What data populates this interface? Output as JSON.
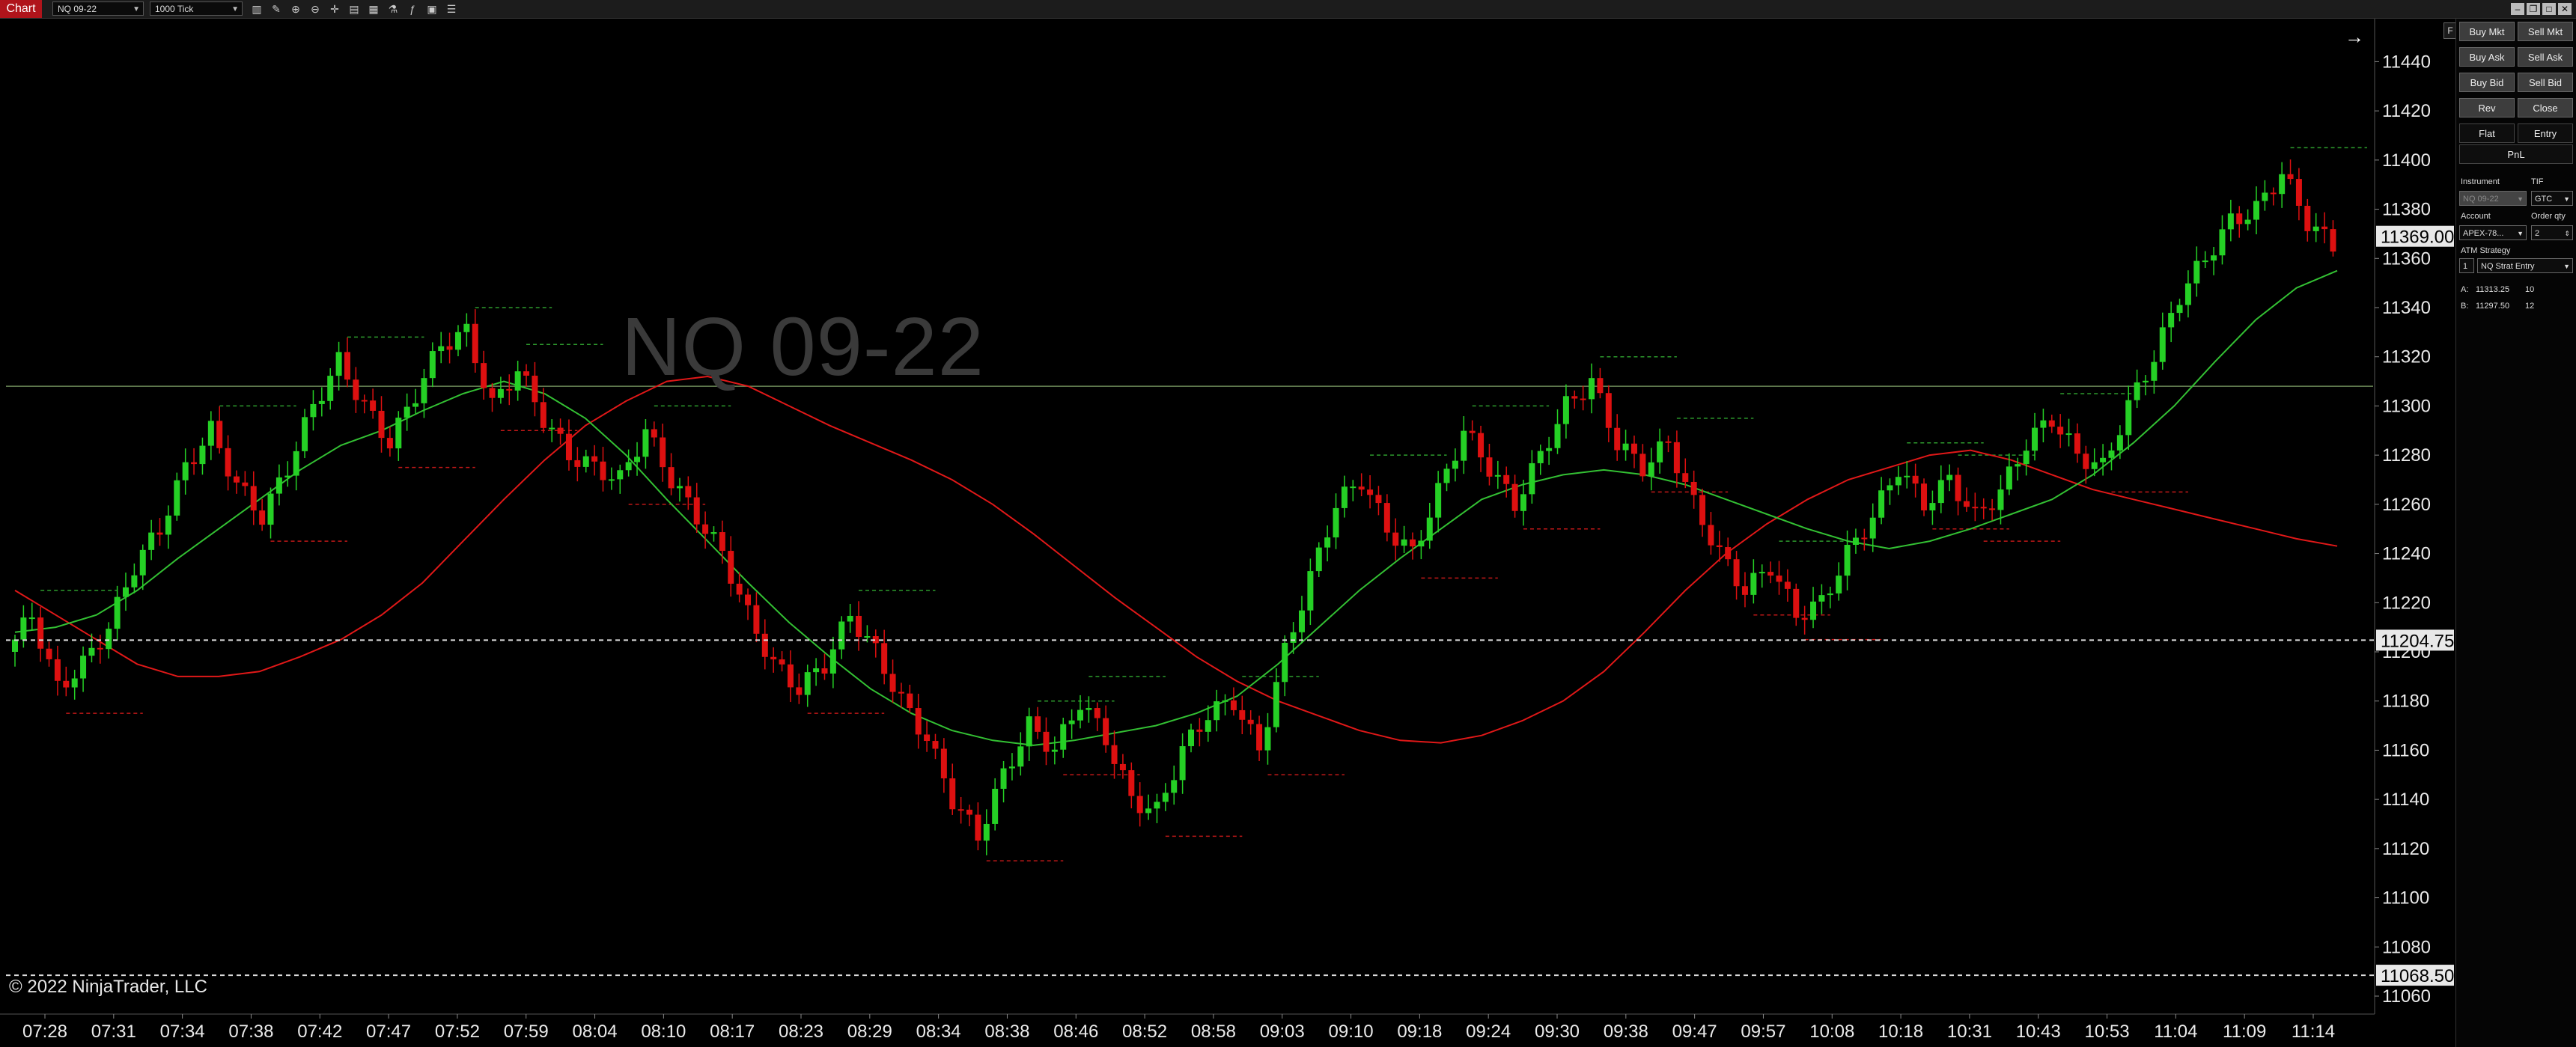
{
  "toolbar": {
    "tab_label": "Chart",
    "instrument": "NQ 09-22",
    "bar_type": "1000 Tick",
    "icons": [
      "bars-icon",
      "pencil-icon",
      "zoom-in-icon",
      "zoom-out-icon",
      "crosshair-icon",
      "data-box-icon",
      "properties-icon",
      "strategies-icon",
      "indicators-icon",
      "templates-icon"
    ]
  },
  "chart": {
    "watermark": "NQ 09-22",
    "copyright": "© 2022 NinjaTrader, LLC",
    "colors": {
      "up": "#25d025",
      "down": "#dd1010",
      "green_ma": "#33c033",
      "red_ma": "#e01818",
      "bg": "#000000"
    }
  },
  "chart_data": {
    "type": "candlestick",
    "instrument": "NQ 09-22",
    "ylim": [
      11060,
      11450
    ],
    "y_ticks": [
      11060,
      11080,
      11100,
      11120,
      11140,
      11160,
      11180,
      11200,
      11220,
      11240,
      11260,
      11280,
      11300,
      11320,
      11340,
      11360,
      11380,
      11400,
      11420,
      11440
    ],
    "x_ticks": [
      "07:28",
      "07:31",
      "07:34",
      "07:38",
      "07:42",
      "07:47",
      "07:52",
      "07:59",
      "08:04",
      "08:10",
      "08:17",
      "08:23",
      "08:29",
      "08:34",
      "08:38",
      "08:46",
      "08:52",
      "08:58",
      "09:03",
      "09:10",
      "09:18",
      "09:24",
      "09:30",
      "09:38",
      "09:47",
      "09:57",
      "10:08",
      "10:18",
      "10:31",
      "10:43",
      "10:53",
      "11:04",
      "11:09",
      "11:14"
    ],
    "price_markers": {
      "last_price": 11369.0,
      "ask_line": 11204.75,
      "bottom_line": 11068.5
    },
    "horizontal_line": 11308,
    "close_path": [
      11200,
      11215,
      11185,
      11195,
      11210,
      11235,
      11250,
      11275,
      11290,
      11268,
      11255,
      11275,
      11300,
      11318,
      11300,
      11285,
      11305,
      11325,
      11330,
      11300,
      11315,
      11295,
      11280,
      11275,
      11270,
      11290,
      11270,
      11255,
      11240,
      11215,
      11195,
      11185,
      11195,
      11215,
      11200,
      11180,
      11165,
      11140,
      11125,
      11150,
      11170,
      11160,
      11180,
      11165,
      11140,
      11135,
      11160,
      11175,
      11180,
      11160,
      11200,
      11230,
      11260,
      11270,
      11250,
      11240,
      11265,
      11290,
      11275,
      11260,
      11280,
      11300,
      11310,
      11285,
      11275,
      11285,
      11260,
      11240,
      11225,
      11235,
      11215,
      11220,
      11240,
      11255,
      11275,
      11260,
      11270,
      11255,
      11265,
      11285,
      11295,
      11280,
      11275,
      11300,
      11320,
      11345,
      11360,
      11375,
      11380,
      11395,
      11375,
      11365
    ],
    "green_ma": [
      11208,
      11210,
      11215,
      11225,
      11238,
      11250,
      11262,
      11274,
      11284,
      11290,
      11298,
      11305,
      11310,
      11305,
      11295,
      11280,
      11262,
      11245,
      11228,
      11212,
      11198,
      11185,
      11175,
      11168,
      11164,
      11162,
      11164,
      11167,
      11170,
      11175,
      11182,
      11195,
      11210,
      11225,
      11238,
      11250,
      11262,
      11268,
      11272,
      11274,
      11272,
      11268,
      11262,
      11256,
      11250,
      11245,
      11242,
      11245,
      11250,
      11256,
      11262,
      11272,
      11285,
      11300,
      11318,
      11335,
      11348,
      11355
    ],
    "red_ma": [
      11225,
      11215,
      11205,
      11195,
      11190,
      11190,
      11192,
      11198,
      11205,
      11215,
      11228,
      11245,
      11262,
      11278,
      11292,
      11302,
      11310,
      11312,
      11308,
      11300,
      11292,
      11285,
      11278,
      11270,
      11260,
      11248,
      11235,
      11222,
      11210,
      11198,
      11188,
      11180,
      11174,
      11168,
      11164,
      11163,
      11166,
      11172,
      11180,
      11192,
      11208,
      11225,
      11240,
      11252,
      11262,
      11270,
      11275,
      11280,
      11282,
      11278,
      11272,
      11266,
      11262,
      11258,
      11254,
      11250,
      11246,
      11243
    ]
  },
  "panel": {
    "f_button": "F",
    "buttons": [
      {
        "left": "Buy Mkt",
        "right": "Sell Mkt"
      },
      {
        "left": "Buy Ask",
        "right": "Sell Ask"
      },
      {
        "left": "Buy Bid",
        "right": "Sell Bid"
      },
      {
        "left": "Rev",
        "right": "Close"
      }
    ],
    "flat": "Flat",
    "entry": "Entry",
    "pnl": "PnL",
    "instrument_label": "Instrument",
    "instrument_value": "NQ 09-22",
    "tif_label": "TIF",
    "tif_value": "GTC",
    "account_label": "Account",
    "account_value": "APEX-78...",
    "order_qty_label": "Order qty",
    "order_qty_value": "2",
    "atm_label": "ATM Strategy",
    "atm_value": "NQ Strat Entry",
    "atm_count": "1",
    "ask_label": "A:",
    "ask_price": "11313.25",
    "ask_size": "10",
    "bid_label": "B:",
    "bid_price": "11297.50",
    "bid_size": "12"
  }
}
